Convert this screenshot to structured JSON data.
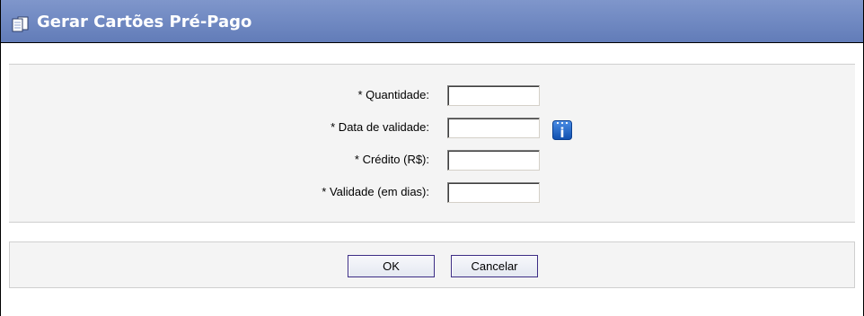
{
  "window": {
    "title": "Gerar Cartões Pré-Pago",
    "title_icon": "documents-icon"
  },
  "form": {
    "fields": [
      {
        "label": "* Quantidade:",
        "value": "",
        "placeholder": ""
      },
      {
        "label": "* Data de validade:",
        "value": "",
        "placeholder": ""
      },
      {
        "label": "* Crédito (R$):",
        "value": "",
        "placeholder": ""
      },
      {
        "label": "* Validade (em dias):",
        "value": "",
        "placeholder": ""
      }
    ],
    "calendar_button": {
      "icon": "calendar-info-icon",
      "glyph": "i"
    }
  },
  "actions": {
    "ok_label": "OK",
    "cancel_label": "Cancelar"
  },
  "colors": {
    "titlebar": "#6f88c1",
    "panel_background": "#f4f4f4",
    "button_border": "#3c2d85",
    "calendar_icon": "#1c5fc4"
  }
}
